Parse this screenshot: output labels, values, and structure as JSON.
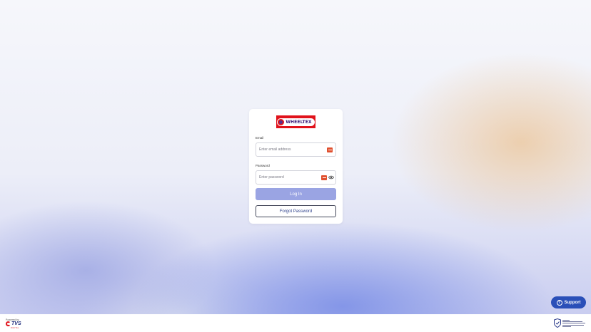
{
  "brand": {
    "logo_text": "WHEELTEX"
  },
  "form": {
    "email_label": "Email",
    "email_placeholder": "Enter email address",
    "password_label": "Password",
    "password_placeholder": "Enter password",
    "login_label": "Log In",
    "forgot_label": "Forgot Password"
  },
  "support": {
    "label": "Support",
    "icon": "question-icon"
  },
  "footer": {
    "powered_by": "Powered by",
    "vendor_logo_text": "TVS",
    "vendor_logo_subtext": "DIGITAL"
  },
  "colors": {
    "primary_button": "#9aa4e3",
    "support_button": "#2a4fb8",
    "logo_red": "#e0121b"
  }
}
